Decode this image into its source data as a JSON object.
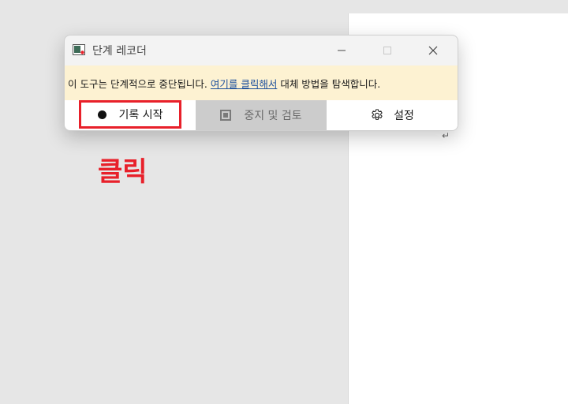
{
  "window": {
    "title": "단계 레코더",
    "controls": [
      "minimize",
      "maximize",
      "close"
    ]
  },
  "info_bar": {
    "text_before": "이 도구는 단계적으로 중단됩니다. ",
    "link_text": "여기를 클릭해서",
    "text_after": " 대체 방법을 탐색합니다."
  },
  "toolbar": {
    "record_label": "기록 시작",
    "stop_label": "중지 및 검토",
    "settings_label": "설정"
  },
  "annotation": {
    "callout_text": "클릭",
    "highlight_color": "#e8202a"
  },
  "document": {
    "paragraph_mark": "↵"
  }
}
